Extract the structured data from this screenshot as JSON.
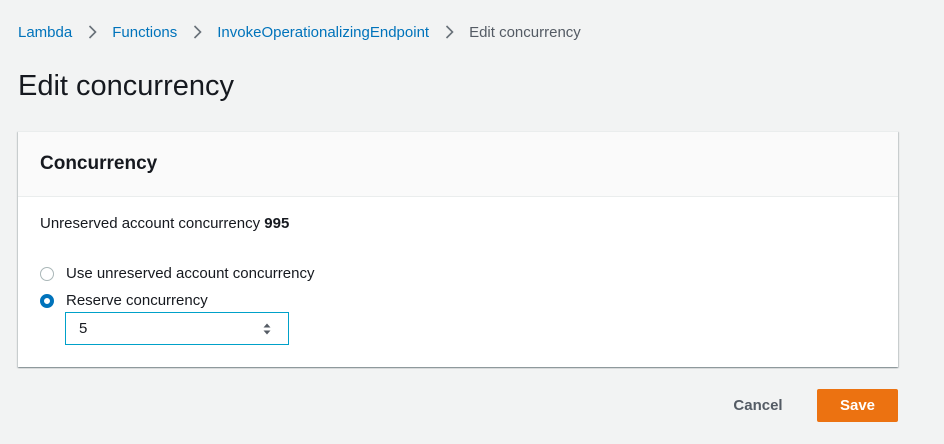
{
  "breadcrumb": {
    "items": [
      {
        "label": "Lambda"
      },
      {
        "label": "Functions"
      },
      {
        "label": "InvokeOperationalizingEndpoint"
      },
      {
        "label": "Edit concurrency"
      }
    ]
  },
  "page": {
    "title": "Edit concurrency"
  },
  "panel": {
    "title": "Concurrency",
    "unreserved_label": "Unreserved account concurrency",
    "unreserved_value": "995",
    "options": [
      {
        "label": "Use unreserved account concurrency",
        "selected": false
      },
      {
        "label": "Reserve concurrency",
        "selected": true
      }
    ],
    "reserved_value": "5"
  },
  "actions": {
    "cancel_label": "Cancel",
    "save_label": "Save"
  },
  "icons": {
    "separator": "chevron-right-icon",
    "stepper": "stepper-arrows-icon"
  },
  "colors": {
    "link": "#0073bb",
    "primary": "#ec7211",
    "focus": "#00a1c9",
    "background": "#f2f3f3"
  }
}
